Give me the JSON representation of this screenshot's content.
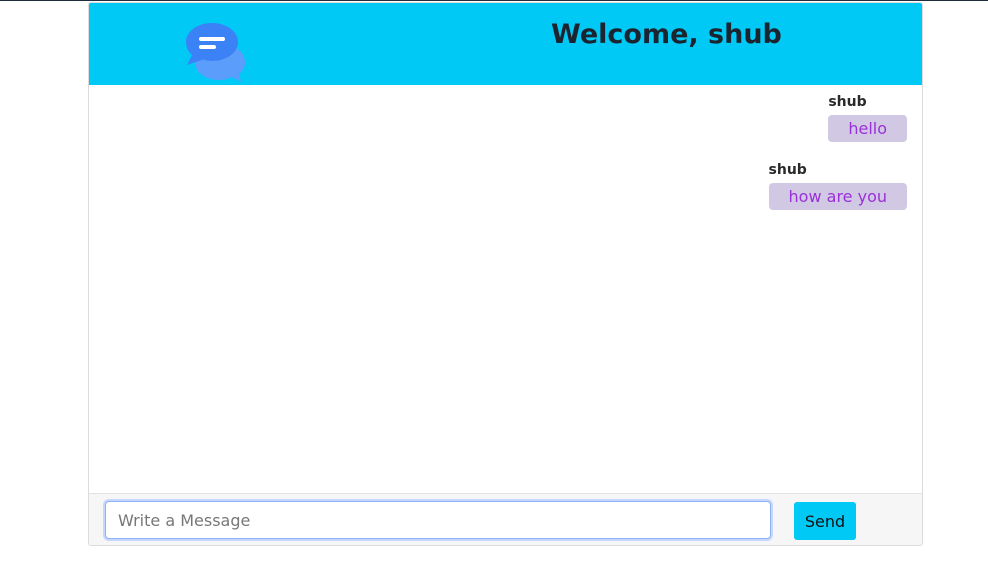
{
  "header": {
    "title": "Welcome, shub",
    "logo_icon": "chat-bubbles-icon",
    "background_color": "#00c9f5"
  },
  "messages": [
    {
      "author": "shub",
      "text": "hello"
    },
    {
      "author": "shub",
      "text": "how are you"
    }
  ],
  "composer": {
    "input_value": "",
    "input_placeholder": "Write a Message",
    "send_label": "Send"
  },
  "colors": {
    "accent": "#00c9f5",
    "bubble_background": "#d1c8e3",
    "bubble_text": "#9b30d9"
  }
}
